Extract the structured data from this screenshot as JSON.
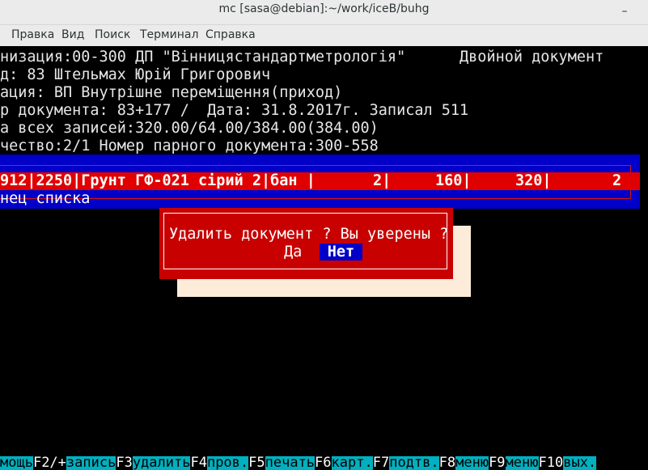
{
  "window": {
    "title": "mc [sasa@debian]:~/work/iceB/buhg",
    "minimize_symbol": "–"
  },
  "menu": [
    "Правка",
    "Вид",
    "Поиск",
    "Терминал",
    "Справка"
  ],
  "header_lines": [
    "низация:00-300 ДП \"Вінницястандартметрологія\"      Двойной документ",
    "д: 83 Штельмах Юрій Григорович",
    "ация: ВП Внутрішне переміщення(приход)",
    "р документа: 83+177 /  Дата: 31.8.2017г. Записал 511",
    "а всех записей:320.00/64.00/384.00(384.00)",
    "чество:2/1 Номер парного документа:300-558"
  ],
  "list": {
    "selected_row": {
      "text": "912|2250|Грунт ГФ-021 сірий 2|бан |",
      "qty": "2|",
      "price": "160|",
      "sum": "320|",
      "last": "2"
    },
    "end_marker": "нец списка"
  },
  "dialog": {
    "message": "Удалить документ ? Вы уверены ?",
    "yes_label": "Да",
    "no_label": "Нет"
  },
  "fkeys": [
    {
      "num": "",
      "label": "мощь"
    },
    {
      "num": "F2/+",
      "label": "запись"
    },
    {
      "num": "F3",
      "label": "удалить"
    },
    {
      "num": "F4",
      "label": "пров."
    },
    {
      "num": "F5",
      "label": "печать"
    },
    {
      "num": "F6",
      "label": "карт."
    },
    {
      "num": "F7",
      "label": "подтв."
    },
    {
      "num": "F8",
      "label": "меню"
    },
    {
      "num": "F9",
      "label": "меню"
    },
    {
      "num": "F10",
      "label": "вых."
    }
  ]
}
